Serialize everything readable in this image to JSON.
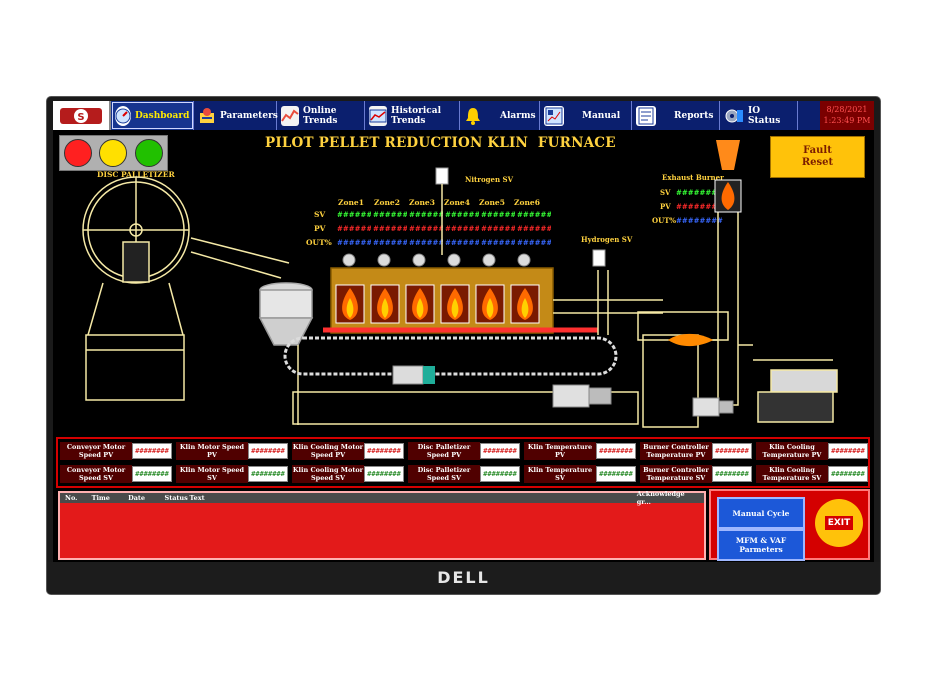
{
  "nav": {
    "buttons": [
      {
        "label": "Dashboard",
        "icon": "dashboard-gauge-icon"
      },
      {
        "label": "Parameters",
        "icon": "parameters-icon"
      },
      {
        "label": "Online Trends",
        "icon": "online-trends-icon"
      },
      {
        "label": "Historical Trends",
        "icon": "historical-trends-icon"
      },
      {
        "label": "Alarms",
        "icon": "bell-icon"
      },
      {
        "label": "Manual",
        "icon": "manual-icon"
      },
      {
        "label": "Reports",
        "icon": "reports-icon"
      },
      {
        "label": "IO Status",
        "icon": "io-status-icon"
      }
    ],
    "date": "8/28/2021",
    "time": "1:23:49 PM"
  },
  "title": "PILOT PELLET REDUCTION KLIN  FURNACE",
  "fault_reset": "Fault\nReset",
  "status_lights": [
    "#ff2020",
    "#ffe000",
    "#21c000"
  ],
  "disc_palletizer": "DISC PALLETIZER",
  "nitrogen_sv": "Nitrogen SV",
  "hydrogen_sv": "Hydrogen SV",
  "exhaust_burner": {
    "label": "Exhaust Burner",
    "sv_label": "SV",
    "sv": "########",
    "pv_label": "PV",
    "pv": "########",
    "out_label": "OUT%",
    "out": "########"
  },
  "zones": {
    "names": [
      "Zone1",
      "Zone2",
      "Zone3",
      "Zone4",
      "Zone5",
      "Zone6"
    ],
    "sv_label": "SV",
    "pv_label": "PV",
    "out_label": "OUT%",
    "sv": [
      "########",
      "########",
      "########",
      "########",
      "########",
      "########"
    ],
    "pv": [
      "########",
      "########",
      "########",
      "########",
      "########",
      "########"
    ],
    "out": [
      "########",
      "########",
      "########",
      "########",
      "########",
      "########"
    ]
  },
  "params": {
    "pv_row": [
      {
        "label": "Conveyor Motor Speed PV",
        "value": "########"
      },
      {
        "label": "Klin Motor Speed PV",
        "value": "########"
      },
      {
        "label": "Klin Cooling Motor Speed PV",
        "value": "########"
      },
      {
        "label": "Disc Palletizer Speed PV",
        "value": "########"
      },
      {
        "label": "Klin Temperature PV",
        "value": "########"
      },
      {
        "label": "Burner Controller Temperature PV",
        "value": "########"
      },
      {
        "label": "Klin Cooling Temperature PV",
        "value": "########"
      }
    ],
    "sv_row": [
      {
        "label": "Conveyor Motor Speed SV",
        "value": "########"
      },
      {
        "label": "Klin Motor Speed SV",
        "value": "########"
      },
      {
        "label": "Klin Cooling Motor Speed SV",
        "value": "########"
      },
      {
        "label": "Disc Palletizer Speed SV",
        "value": "########"
      },
      {
        "label": "Klin Temperature SV",
        "value": "########"
      },
      {
        "label": "Burner Controller Temperature SV",
        "value": "########"
      },
      {
        "label": "Klin Cooling Temperature SV",
        "value": "########"
      }
    ]
  },
  "alarm_table": {
    "columns": [
      "No.",
      "Time",
      "Date",
      "Status",
      "Text"
    ],
    "acknowledge": "Acknowledge gr..."
  },
  "actions": {
    "manual_cycle": "Manual Cycle",
    "mfm_vaf": "MFM & VAF Parmeters",
    "exit": "EXIT"
  },
  "brand": "DELL"
}
